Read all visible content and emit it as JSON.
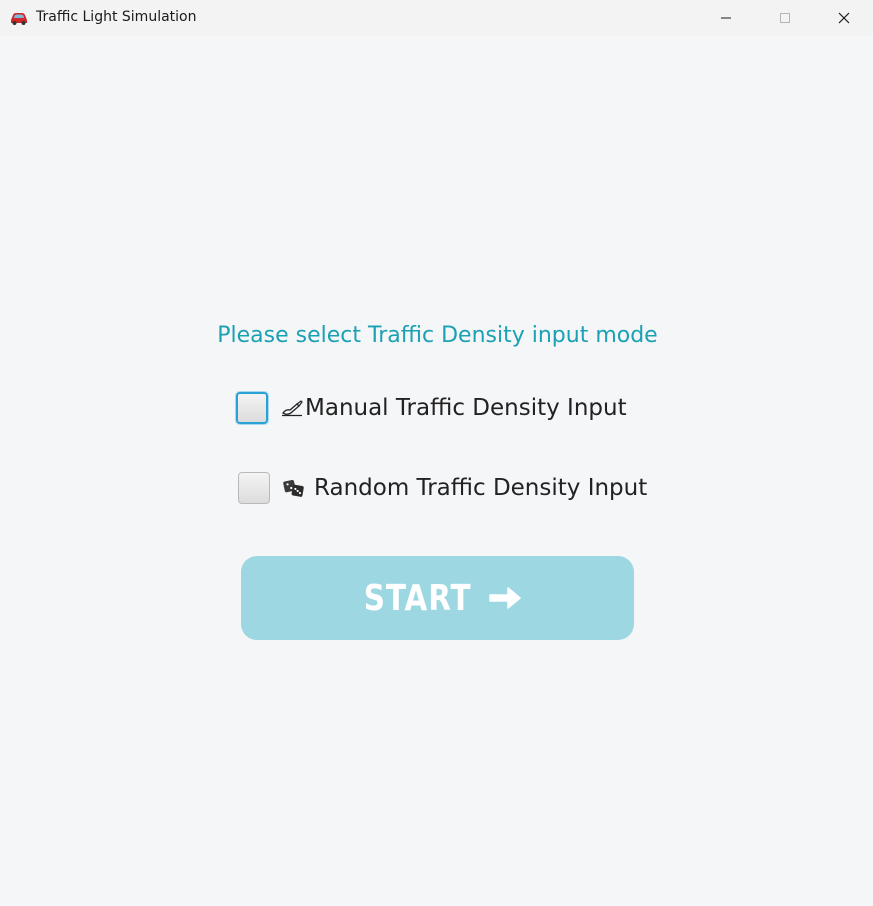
{
  "window": {
    "title": "Traffic Light Simulation",
    "app_icon": "red-car-icon",
    "controls": [
      "minimize-icon",
      "maximize-icon",
      "close-icon"
    ]
  },
  "main": {
    "prompt": "Please select Traffic Density input mode",
    "options": [
      {
        "icon": "writing-hand-icon",
        "label": "Manual Traffic Density Input",
        "checked": false,
        "focused": true
      },
      {
        "icon": "dice-icon",
        "label": "Random Traffic Density Input",
        "checked": false,
        "focused": false
      }
    ],
    "start_button": {
      "label": "START",
      "icon": "right-arrow-icon"
    }
  },
  "colors": {
    "accent": "#1aa1b3",
    "start_button_bg": "#9dd8e2",
    "background": "#f5f6f8",
    "focus_ring": "#2aa1d4"
  }
}
